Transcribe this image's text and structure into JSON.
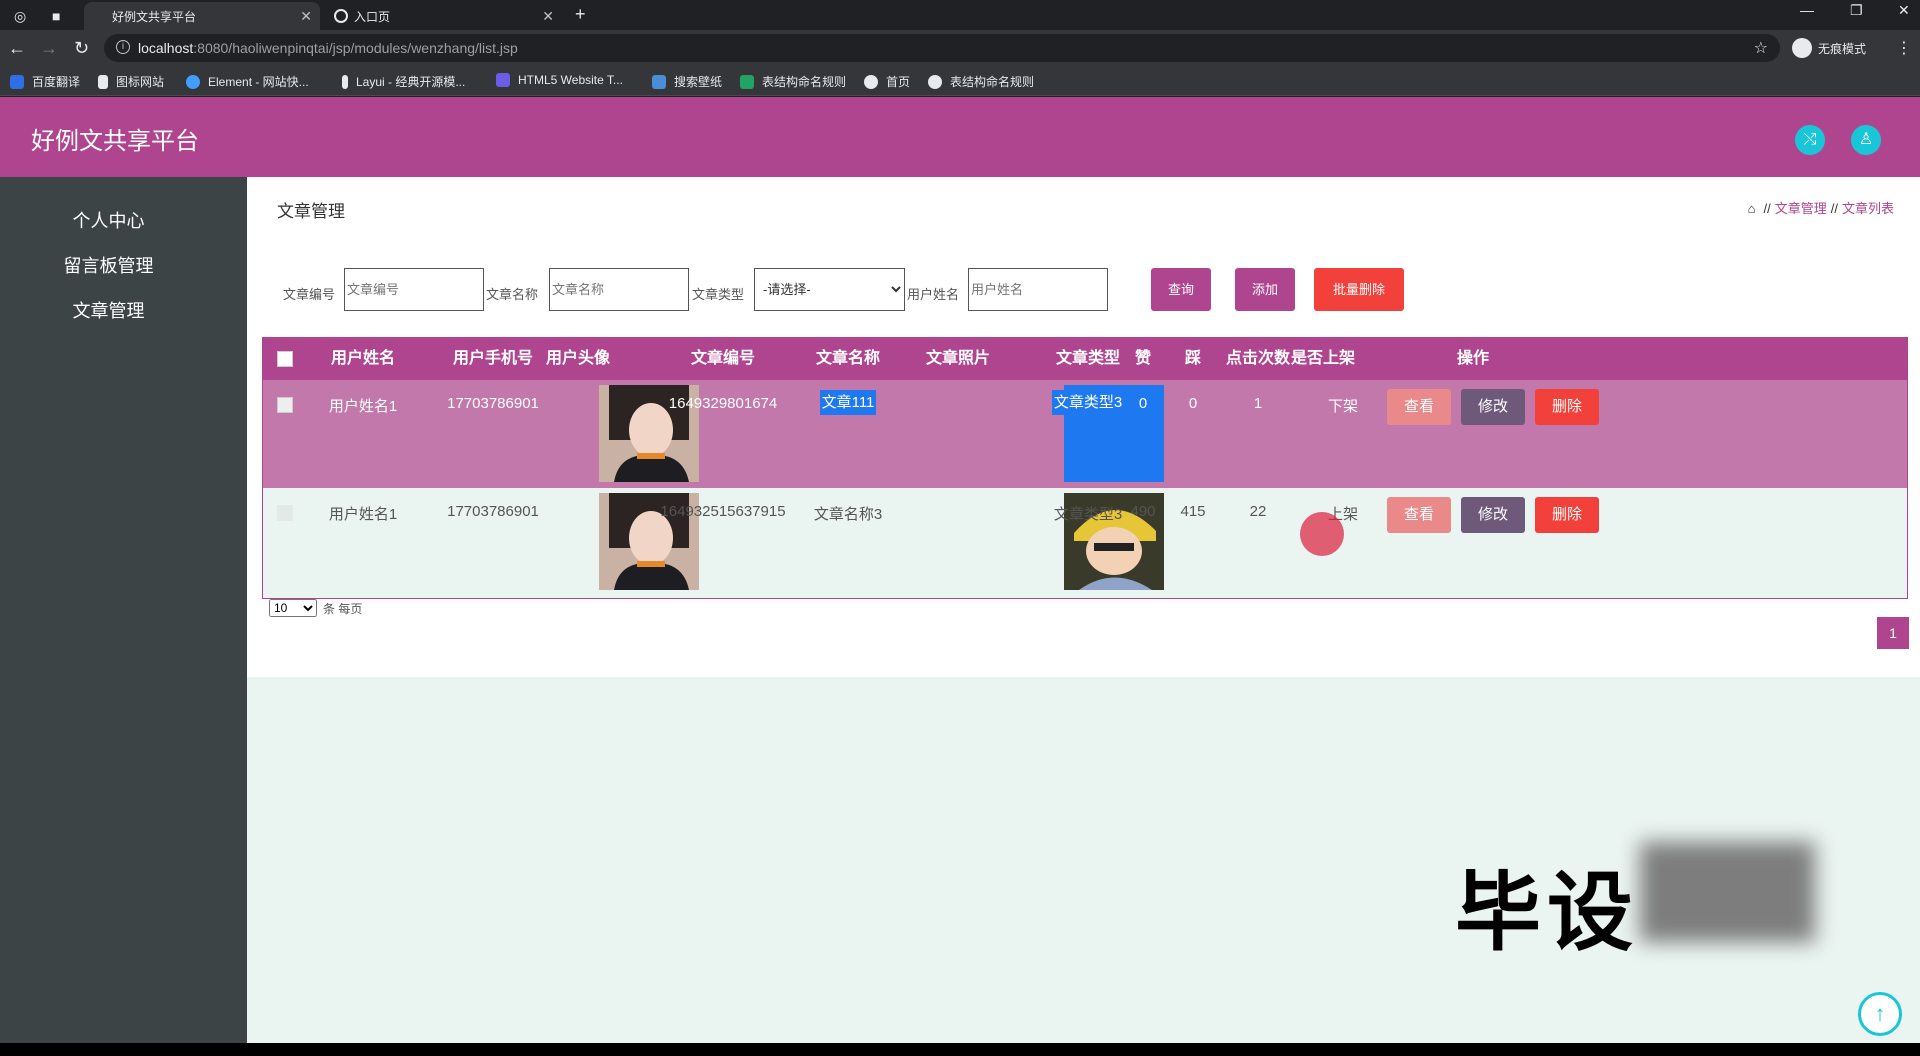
{
  "browser": {
    "tabs": [
      {
        "label": "好例文共享平台",
        "active": true
      },
      {
        "label": "入口页",
        "active": false
      }
    ],
    "url_host": "localhost",
    "url_rest": ":8080/haoliwenpinqtai/jsp/modules/wenzhang/list.jsp",
    "incognito_label": "无痕模式",
    "bookmarks": [
      "百度翻译",
      "图标网站",
      "Element - 网站快...",
      "Layui - 经典开源模...",
      "HTML5 Website T...",
      "搜索壁纸",
      "表结构命名规则",
      "首页",
      "表结构命名规则"
    ]
  },
  "app": {
    "title": "好例文共享平台",
    "accent": "#b0458f",
    "header_icons": [
      "shuffle-icon",
      "user-icon"
    ]
  },
  "sidebar": {
    "items": [
      "个人中心",
      "留言板管理",
      "文章管理"
    ]
  },
  "main": {
    "page_title": "文章管理",
    "breadcrumb": [
      "文章管理",
      "文章列表"
    ],
    "search": {
      "article_no_label": "文章编号",
      "article_no_placeholder": "文章编号",
      "article_name_label": "文章名称",
      "article_name_placeholder": "文章名称",
      "article_type_label": "文章类型",
      "article_type_value": "-请选择-",
      "user_name_label": "用户姓名",
      "user_name_placeholder": "用户姓名"
    },
    "buttons": {
      "query": "查询",
      "add": "添加",
      "batch_delete": "批量删除"
    },
    "table": {
      "headers": [
        "用户姓名",
        "用户手机号",
        "用户头像",
        "文章编号",
        "文章名称",
        "文章照片",
        "文章类型",
        "赞",
        "踩",
        "点击次数",
        "是否上架",
        "操作"
      ],
      "rows": [
        {
          "user_name": "用户姓名1",
          "phone": "17703786901",
          "article_no": "1649329801674",
          "article_name": "文章111",
          "article_type": "文章类型3",
          "likes": "0",
          "dislikes": "0",
          "clicks": "1",
          "status": "下架"
        },
        {
          "user_name": "用户姓名1",
          "phone": "17703786901",
          "article_no": "164932515637915",
          "article_name": "文章名称3",
          "article_type": "文章类型3",
          "likes": "490",
          "dislikes": "415",
          "clicks": "22",
          "status": "上架"
        }
      ],
      "actions": {
        "view": "查看",
        "edit": "修改",
        "delete": "删除"
      }
    },
    "pager": {
      "page_size": "10",
      "per_page_label": "条 每页",
      "current_page": "1"
    }
  },
  "watermark": "毕设"
}
